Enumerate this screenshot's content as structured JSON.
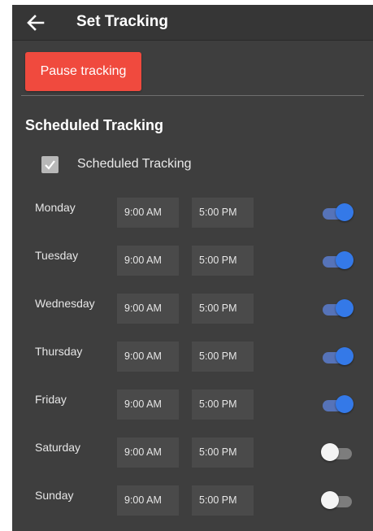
{
  "header": {
    "title": "Set Tracking",
    "back_icon": "arrow-left-icon"
  },
  "actions": {
    "pause_label": "Pause tracking"
  },
  "colors": {
    "accent": "#3479e8",
    "danger": "#f04a3e",
    "background": "#3e3e3e"
  },
  "scheduled": {
    "section_title": "Scheduled Tracking",
    "checkbox_label": "Scheduled Tracking",
    "checkbox_checked": true,
    "days": [
      {
        "name": "Monday",
        "start": "9:00 AM",
        "end": "5:00 PM",
        "enabled": true
      },
      {
        "name": "Tuesday",
        "start": "9:00 AM",
        "end": "5:00 PM",
        "enabled": true
      },
      {
        "name": "Wednesday",
        "start": "9:00 AM",
        "end": "5:00 PM",
        "enabled": true
      },
      {
        "name": "Thursday",
        "start": "9:00 AM",
        "end": "5:00 PM",
        "enabled": true
      },
      {
        "name": "Friday",
        "start": "9:00 AM",
        "end": "5:00 PM",
        "enabled": true
      },
      {
        "name": "Saturday",
        "start": "9:00 AM",
        "end": "5:00 PM",
        "enabled": false
      },
      {
        "name": "Sunday",
        "start": "9:00 AM",
        "end": "5:00 PM",
        "enabled": false
      }
    ]
  }
}
